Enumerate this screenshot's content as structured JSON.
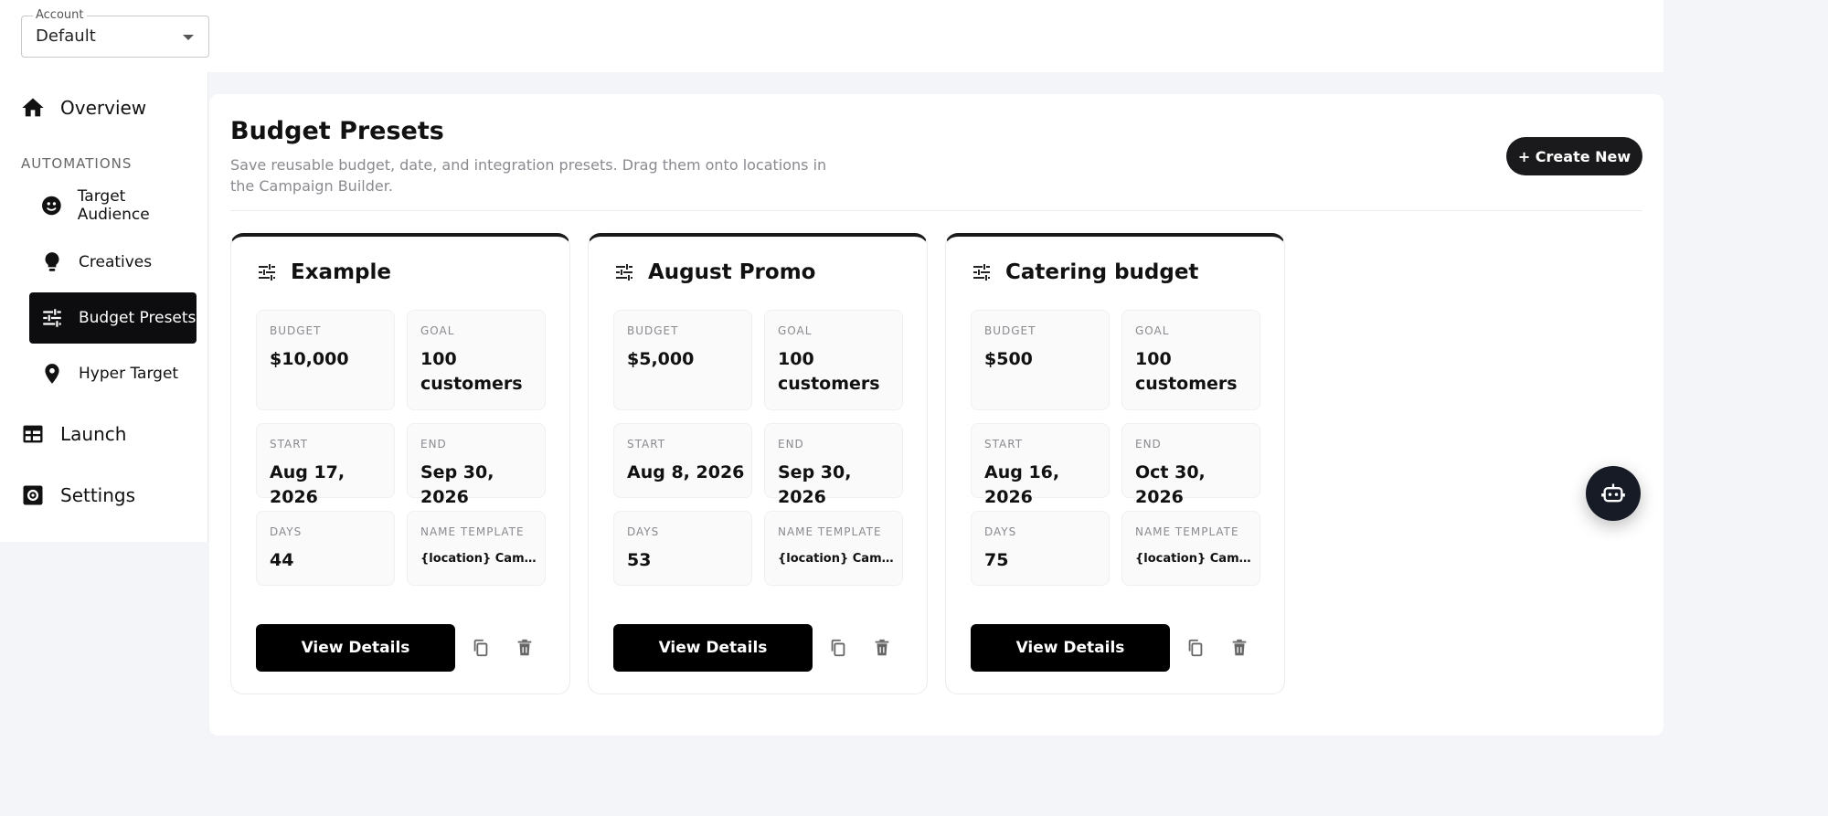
{
  "account": {
    "label": "Account",
    "value": "Default"
  },
  "sidebar": {
    "overview": "Overview",
    "section_label": "AUTOMATIONS",
    "items": [
      {
        "label": "Target Audience",
        "icon": "face-icon"
      },
      {
        "label": "Creatives",
        "icon": "lightbulb-icon"
      },
      {
        "label": "Budget Presets",
        "icon": "tune-icon",
        "active": true
      },
      {
        "label": "Hyper Target",
        "icon": "pin-icon"
      }
    ],
    "launch": "Launch",
    "settings": "Settings"
  },
  "main": {
    "title": "Budget Presets",
    "description": "Save reusable budget, date, and integration presets. Drag them onto locations in the Campaign Builder.",
    "create_label": "+ Create New"
  },
  "field_labels": {
    "budget": "BUDGET",
    "goal": "GOAL",
    "start": "START",
    "end": "END",
    "days": "DAYS",
    "name_template": "NAME TEMPLATE"
  },
  "cards": [
    {
      "title": "Example",
      "budget": "$10,000",
      "goal": "100 customers",
      "start": "Aug 17, 2026",
      "end": "Sep 30, 2026",
      "days": "44",
      "name_template": "{location} Campaign",
      "view_label": "View Details"
    },
    {
      "title": "August Promo",
      "budget": "$5,000",
      "goal": "100 customers",
      "start": "Aug 8, 2026",
      "end": "Sep 30, 2026",
      "days": "53",
      "name_template": "{location} Campaign",
      "view_label": "View Details"
    },
    {
      "title": "Catering budget",
      "budget": "$500",
      "goal": "100 customers",
      "start": "Aug 16, 2026",
      "end": "Oct 30, 2026",
      "days": "75",
      "name_template": "{location} Campaign",
      "view_label": "View Details"
    }
  ],
  "colors": {
    "active_nav": "#0d0d0f",
    "primary_button": "#000000",
    "fab": "#161b26",
    "page_bg": "#f4f5f8"
  }
}
